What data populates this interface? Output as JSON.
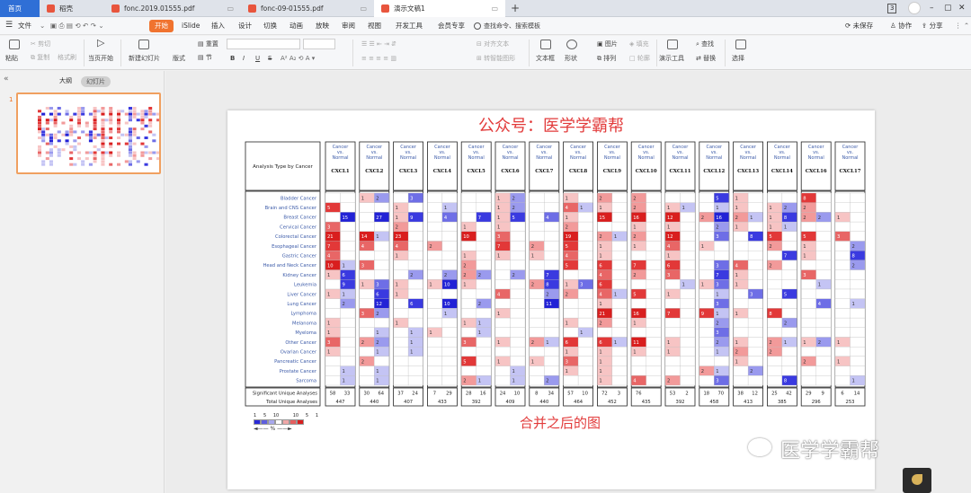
{
  "tabs": [
    {
      "label": "首页",
      "type": "home"
    },
    {
      "label": "稻壳",
      "type": "app",
      "color": "#e8553d"
    },
    {
      "label": "fonc.2019.01555.pdf",
      "type": "pdf",
      "color": "#e8553d"
    },
    {
      "label": "fonc-09-01555.pdf",
      "type": "pdf",
      "color": "#e8553d"
    },
    {
      "label": "演示文稿1",
      "type": "ppt",
      "color": "#e8553d",
      "active": true
    }
  ],
  "window": {
    "page_badge": "3",
    "minimize": "–",
    "restore": "▢",
    "close": "✕"
  },
  "menubar": {
    "file": "文件",
    "items": [
      "开始",
      "iSlide",
      "插入",
      "设计",
      "切换",
      "动画",
      "放映",
      "审阅",
      "视图",
      "开发工具",
      "会员专享"
    ],
    "search": "查找命令、搜索模板",
    "unsaved": "未保存",
    "collab": "协作",
    "share": "分享"
  },
  "ribbon": {
    "paste": "粘贴",
    "cut": "剪切",
    "copy": "复制",
    "format_painter": "格式刷",
    "from_current": "当页开始",
    "new_slide": "新建幻灯片",
    "layout": "版式",
    "section": "节",
    "reset": "重置",
    "font_bold": "B",
    "font_italic": "I",
    "font_underline": "U",
    "font_strike": "S",
    "align_text": "对齐文本",
    "convert_smartart": "转智能图形",
    "textbox": "文本框",
    "shape": "形状",
    "arrange": "排列",
    "outline": "轮廓",
    "picture": "图片",
    "fill": "填充",
    "find": "查找",
    "replace": "替换",
    "present_tool": "演示工具",
    "select": "选择"
  },
  "panel": {
    "outline_tab": "大纲",
    "slides_tab": "幻灯片",
    "slide_num": "1",
    "collapse": "«"
  },
  "slide": {
    "title": "公众号：医学学霸帮",
    "caption": "合并之后的图",
    "legend_nums": [
      "1",
      "5",
      "10",
      "",
      "10",
      "5",
      "1"
    ],
    "legend_arrow": "◄—— % ——►"
  },
  "watermark": {
    "text": "医学学霸帮"
  },
  "chart_data": {
    "type": "heatmap",
    "row_header": "Analysis Type by Cancer",
    "col_header": "Cancer vs. Normal",
    "genes": [
      "CXCL1",
      "CXCL2",
      "CXCL3",
      "CXCL4",
      "CXCL5",
      "CXCL6",
      "CXCL7",
      "CXCL8",
      "CXCL9",
      "CXCL10",
      "CXCL11",
      "CXCL12",
      "CXCL13",
      "CXCL14",
      "CXCL16",
      "CXCL17"
    ],
    "cancers": [
      "Bladder Cancer",
      "Brain and CNS Cancer",
      "Breast Cancer",
      "Cervical Cancer",
      "Colorectal Cancer",
      "Esophageal Cancer",
      "Gastric Cancer",
      "Head and Neck Cancer",
      "Kidney Cancer",
      "Leukemia",
      "Liver Cancer",
      "Lung Cancer",
      "Lymphoma",
      "Melanoma",
      "Myeloma",
      "Other Cancer",
      "Ovarian Cancer",
      "Pancreatic Cancer",
      "Prostate Cancer",
      "Sarcoma"
    ],
    "summary_labels": [
      "Significant Unique Analyses",
      "Total Unique Analyses"
    ],
    "significant_up": [
      58,
      30,
      37,
      7,
      28,
      24,
      8,
      57,
      72,
      76,
      53,
      18,
      38,
      25,
      29,
      6
    ],
    "significant_down": [
      33,
      64,
      24,
      29,
      16,
      10,
      34,
      10,
      3,
      null,
      2,
      70,
      12,
      42,
      9,
      14
    ],
    "total": [
      447,
      440,
      407,
      433,
      392,
      409,
      440,
      464,
      452,
      435,
      392,
      458,
      413,
      385,
      296,
      253
    ],
    "cells": [
      [
        [
          null,
          null
        ],
        [
          5,
          null
        ],
        [
          null,
          15
        ],
        [
          3,
          null
        ],
        [
          21,
          null
        ],
        [
          7,
          null
        ],
        [
          4,
          null
        ],
        [
          10,
          1
        ],
        [
          1,
          6
        ],
        [
          null,
          9
        ],
        [
          1,
          1
        ],
        [
          null,
          2
        ],
        [
          null,
          null
        ],
        [
          1,
          null
        ],
        [
          1,
          null
        ],
        [
          3,
          null
        ],
        [
          1,
          null
        ],
        [
          null,
          null
        ],
        [
          null,
          1
        ],
        [
          null,
          1
        ]
      ],
      [
        [
          1,
          2
        ],
        [
          null,
          null
        ],
        [
          null,
          27
        ],
        [
          null,
          null
        ],
        [
          14,
          1
        ],
        [
          4,
          null
        ],
        [
          null,
          null
        ],
        [
          3,
          null
        ],
        [
          null,
          null
        ],
        [
          1,
          3
        ],
        [
          null,
          6
        ],
        [
          null,
          12
        ],
        [
          3,
          2
        ],
        [
          null,
          null
        ],
        [
          null,
          1
        ],
        [
          2,
          2
        ],
        [
          null,
          1
        ],
        [
          2,
          null
        ],
        [
          null,
          1
        ],
        [
          null,
          1
        ]
      ],
      [
        [
          null,
          3
        ],
        [
          1,
          null
        ],
        [
          1,
          9
        ],
        [
          2,
          null
        ],
        [
          23,
          null
        ],
        [
          4,
          null
        ],
        [
          1,
          null
        ],
        [
          null,
          null
        ],
        [
          null,
          2
        ],
        [
          1,
          null
        ],
        [
          1,
          null
        ],
        [
          null,
          6
        ],
        [
          null,
          null
        ],
        [
          1,
          null
        ],
        [
          null,
          1
        ],
        [
          null,
          1
        ],
        [
          null,
          1
        ],
        [
          null,
          null
        ],
        [
          null,
          null
        ],
        [
          null,
          null
        ]
      ],
      [
        [
          null,
          null
        ],
        [
          null,
          1
        ],
        [
          null,
          4
        ],
        [
          null,
          null
        ],
        [
          null,
          null
        ],
        [
          2,
          null
        ],
        [
          null,
          null
        ],
        [
          null,
          null
        ],
        [
          null,
          2
        ],
        [
          1,
          10
        ],
        [
          null,
          null
        ],
        [
          null,
          10
        ],
        [
          null,
          1
        ],
        [
          null,
          null
        ],
        [
          1,
          null
        ],
        [
          null,
          null
        ],
        [
          null,
          null
        ],
        [
          null,
          null
        ],
        [
          null,
          null
        ],
        [
          null,
          null
        ]
      ],
      [
        [
          null,
          null
        ],
        [
          null,
          null
        ],
        [
          null,
          7
        ],
        [
          1,
          null
        ],
        [
          10,
          null
        ],
        [
          null,
          null
        ],
        [
          1,
          null
        ],
        [
          2,
          null
        ],
        [
          2,
          2
        ],
        [
          1,
          null
        ],
        [
          null,
          null
        ],
        [
          null,
          2
        ],
        [
          null,
          null
        ],
        [
          1,
          1
        ],
        [
          null,
          1
        ],
        [
          3,
          null
        ],
        [
          null,
          null
        ],
        [
          5,
          null
        ],
        [
          null,
          null
        ],
        [
          2,
          1
        ]
      ],
      [
        [
          1,
          2
        ],
        [
          1,
          2
        ],
        [
          1,
          5
        ],
        [
          1,
          null
        ],
        [
          3,
          null
        ],
        [
          7,
          null
        ],
        [
          1,
          null
        ],
        [
          null,
          null
        ],
        [
          null,
          2
        ],
        [
          null,
          null
        ],
        [
          4,
          null
        ],
        [
          null,
          null
        ],
        [
          1,
          null
        ],
        [
          null,
          null
        ],
        [
          null,
          null
        ],
        [
          1,
          null
        ],
        [
          null,
          null
        ],
        [
          1,
          null
        ],
        [
          null,
          1
        ],
        [
          null,
          1
        ]
      ],
      [
        [
          null,
          null
        ],
        [
          null,
          null
        ],
        [
          null,
          4
        ],
        [
          null,
          null
        ],
        [
          null,
          null
        ],
        [
          2,
          null
        ],
        [
          1,
          null
        ],
        [
          null,
          null
        ],
        [
          null,
          7
        ],
        [
          2,
          8
        ],
        [
          null,
          2
        ],
        [
          null,
          11
        ],
        [
          null,
          null
        ],
        [
          null,
          null
        ],
        [
          null,
          null
        ],
        [
          2,
          1
        ],
        [
          null,
          null
        ],
        [
          1,
          null
        ],
        [
          null,
          null
        ],
        [
          null,
          2
        ]
      ],
      [
        [
          1,
          null
        ],
        [
          4,
          1
        ],
        [
          1,
          null
        ],
        [
          2,
          null
        ],
        [
          19,
          null
        ],
        [
          5,
          null
        ],
        [
          4,
          null
        ],
        [
          5,
          null
        ],
        [
          null,
          null
        ],
        [
          1,
          3
        ],
        [
          2,
          null
        ],
        [
          null,
          null
        ],
        [
          null,
          null
        ],
        [
          1,
          null
        ],
        [
          null,
          1
        ],
        [
          6,
          null
        ],
        [
          1,
          null
        ],
        [
          3,
          null
        ],
        [
          1,
          null
        ],
        [
          null,
          null
        ]
      ],
      [
        [
          2,
          null
        ],
        [
          1,
          null
        ],
        [
          15,
          null
        ],
        [
          null,
          null
        ],
        [
          2,
          1
        ],
        [
          1,
          null
        ],
        [
          1,
          null
        ],
        [
          6,
          null
        ],
        [
          4,
          null
        ],
        [
          6,
          null
        ],
        [
          4,
          1
        ],
        [
          1,
          null
        ],
        [
          21,
          null
        ],
        [
          2,
          null
        ],
        [
          null,
          null
        ],
        [
          6,
          1
        ],
        [
          1,
          null
        ],
        [
          1,
          null
        ],
        [
          1,
          null
        ],
        [
          1,
          null
        ]
      ],
      [
        [
          2,
          null
        ],
        [
          2,
          null
        ],
        [
          16,
          null
        ],
        [
          1,
          null
        ],
        [
          2,
          null
        ],
        [
          1,
          null
        ],
        [
          null,
          null
        ],
        [
          7,
          null
        ],
        [
          2,
          null
        ],
        [
          null,
          null
        ],
        [
          5,
          null
        ],
        [
          null,
          null
        ],
        [
          16,
          null
        ],
        [
          1,
          null
        ],
        [
          null,
          null
        ],
        [
          11,
          null
        ],
        [
          1,
          null
        ],
        [
          null,
          null
        ],
        [
          null,
          null
        ],
        [
          4,
          null
        ]
      ],
      [
        [
          null,
          null
        ],
        [
          1,
          1
        ],
        [
          12,
          null
        ],
        [
          1,
          null
        ],
        [
          12,
          null
        ],
        [
          4,
          null
        ],
        [
          1,
          null
        ],
        [
          6,
          null
        ],
        [
          3,
          null
        ],
        [
          null,
          1
        ],
        [
          1,
          null
        ],
        [
          null,
          null
        ],
        [
          7,
          null
        ],
        [
          null,
          null
        ],
        [
          null,
          null
        ],
        [
          1,
          null
        ],
        [
          1,
          null
        ],
        [
          null,
          null
        ],
        [
          null,
          null
        ],
        [
          2,
          null
        ]
      ],
      [
        [
          null,
          5
        ],
        [
          null,
          1
        ],
        [
          2,
          16
        ],
        [
          null,
          2
        ],
        [
          null,
          3
        ],
        [
          1,
          null
        ],
        [
          null,
          null
        ],
        [
          null,
          3
        ],
        [
          null,
          7
        ],
        [
          1,
          3
        ],
        [
          null,
          1
        ],
        [
          null,
          3
        ],
        [
          9,
          1
        ],
        [
          null,
          2
        ],
        [
          null,
          3
        ],
        [
          null,
          2
        ],
        [
          null,
          1
        ],
        [
          null,
          null
        ],
        [
          2,
          1
        ],
        [
          null,
          3
        ]
      ],
      [
        [
          1,
          null
        ],
        [
          1,
          null
        ],
        [
          2,
          1
        ],
        [
          1,
          null
        ],
        [
          null,
          8
        ],
        [
          null,
          null
        ],
        [
          null,
          null
        ],
        [
          4,
          null
        ],
        [
          1,
          null
        ],
        [
          1,
          null
        ],
        [
          null,
          3
        ],
        [
          null,
          null
        ],
        [
          1,
          null
        ],
        [
          null,
          null
        ],
        [
          null,
          null
        ],
        [
          1,
          null
        ],
        [
          2,
          null
        ],
        [
          1,
          null
        ],
        [
          null,
          2
        ],
        [
          null,
          null
        ]
      ],
      [
        [
          null,
          null
        ],
        [
          1,
          2
        ],
        [
          1,
          8
        ],
        [
          1,
          1
        ],
        [
          5,
          null
        ],
        [
          2,
          null
        ],
        [
          null,
          7
        ],
        [
          2,
          null
        ],
        [
          null,
          null
        ],
        [
          null,
          null
        ],
        [
          null,
          5
        ],
        [
          null,
          null
        ],
        [
          8,
          null
        ],
        [
          null,
          2
        ],
        [
          null,
          null
        ],
        [
          2,
          1
        ],
        [
          2,
          null
        ],
        [
          null,
          null
        ],
        [
          null,
          null
        ],
        [
          null,
          8
        ]
      ],
      [
        [
          8,
          null
        ],
        [
          2,
          null
        ],
        [
          2,
          2
        ],
        [
          null,
          null
        ],
        [
          5,
          null
        ],
        [
          1,
          null
        ],
        [
          1,
          null
        ],
        [
          null,
          null
        ],
        [
          3,
          null
        ],
        [
          null,
          1
        ],
        [
          null,
          null
        ],
        [
          null,
          4
        ],
        [
          null,
          null
        ],
        [
          null,
          null
        ],
        [
          null,
          null
        ],
        [
          1,
          2
        ],
        [
          null,
          null
        ],
        [
          2,
          null
        ],
        [
          null,
          null
        ],
        [
          null,
          null
        ]
      ],
      [
        [
          null,
          null
        ],
        [
          null,
          null
        ],
        [
          1,
          null
        ],
        [
          null,
          null
        ],
        [
          3,
          null
        ],
        [
          null,
          2
        ],
        [
          null,
          8
        ],
        [
          null,
          2
        ],
        [
          null,
          null
        ],
        [
          null,
          null
        ],
        [
          null,
          null
        ],
        [
          null,
          1
        ],
        [
          null,
          null
        ],
        [
          null,
          null
        ],
        [
          null,
          null
        ],
        [
          1,
          null
        ],
        [
          null,
          null
        ],
        [
          1,
          null
        ],
        [
          null,
          null
        ],
        [
          null,
          1
        ]
      ]
    ]
  }
}
